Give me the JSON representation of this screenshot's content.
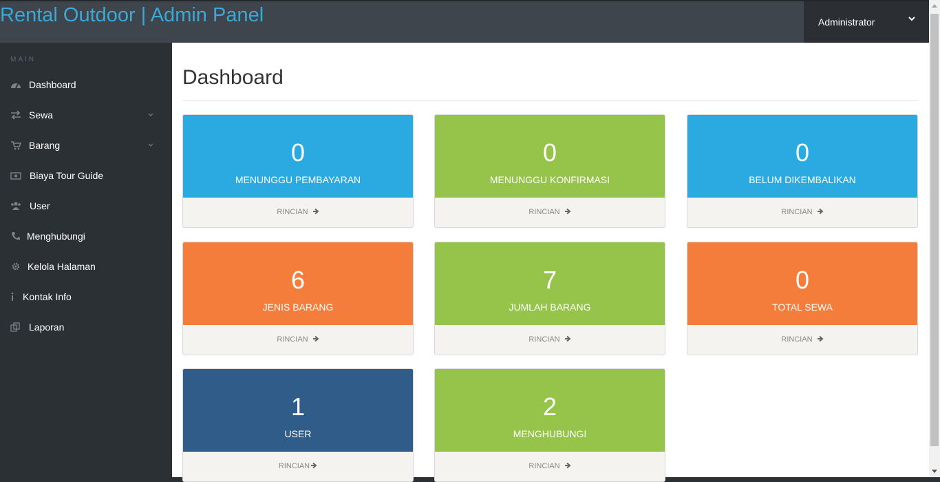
{
  "header": {
    "brand": "Rental Outdoor | Admin Panel",
    "user": "Administrator"
  },
  "sidebar": {
    "heading": "MAIN",
    "items": [
      {
        "label": "Dashboard"
      },
      {
        "label": "Sewa"
      },
      {
        "label": "Barang"
      },
      {
        "label": "Biaya Tour Guide"
      },
      {
        "label": "User"
      },
      {
        "label": "Menghubungi"
      },
      {
        "label": "Kelola Halaman"
      },
      {
        "label": "Kontak Info"
      },
      {
        "label": "Laporan"
      }
    ]
  },
  "main": {
    "title": "Dashboard",
    "cards": [
      {
        "value": "0",
        "caption": "MENUNGGU PEMBAYARAN",
        "link": "RINCIAN",
        "color": "#2baae1"
      },
      {
        "value": "0",
        "caption": "MENUNGGU KONFIRMASI",
        "link": "RINCIAN",
        "color": "#96c44a"
      },
      {
        "value": "0",
        "caption": "BELUM DIKEMBALIKAN",
        "link": "RINCIAN",
        "color": "#2baae1"
      },
      {
        "value": "6",
        "caption": "JENIS BARANG",
        "link": "RINCIAN",
        "color": "#f47d3c"
      },
      {
        "value": "7",
        "caption": "JUMLAH BARANG",
        "link": "RINCIAN",
        "color": "#96c44a"
      },
      {
        "value": "0",
        "caption": "TOTAL SEWA",
        "link": "RINCIAN",
        "color": "#f47d3c"
      },
      {
        "value": "1",
        "caption": "USER",
        "link": "RINCIAN",
        "color": "#305c89"
      },
      {
        "value": "2",
        "caption": "MENGHUBUNGI",
        "link": "RINCIAN",
        "color": "#96c44a"
      }
    ]
  }
}
